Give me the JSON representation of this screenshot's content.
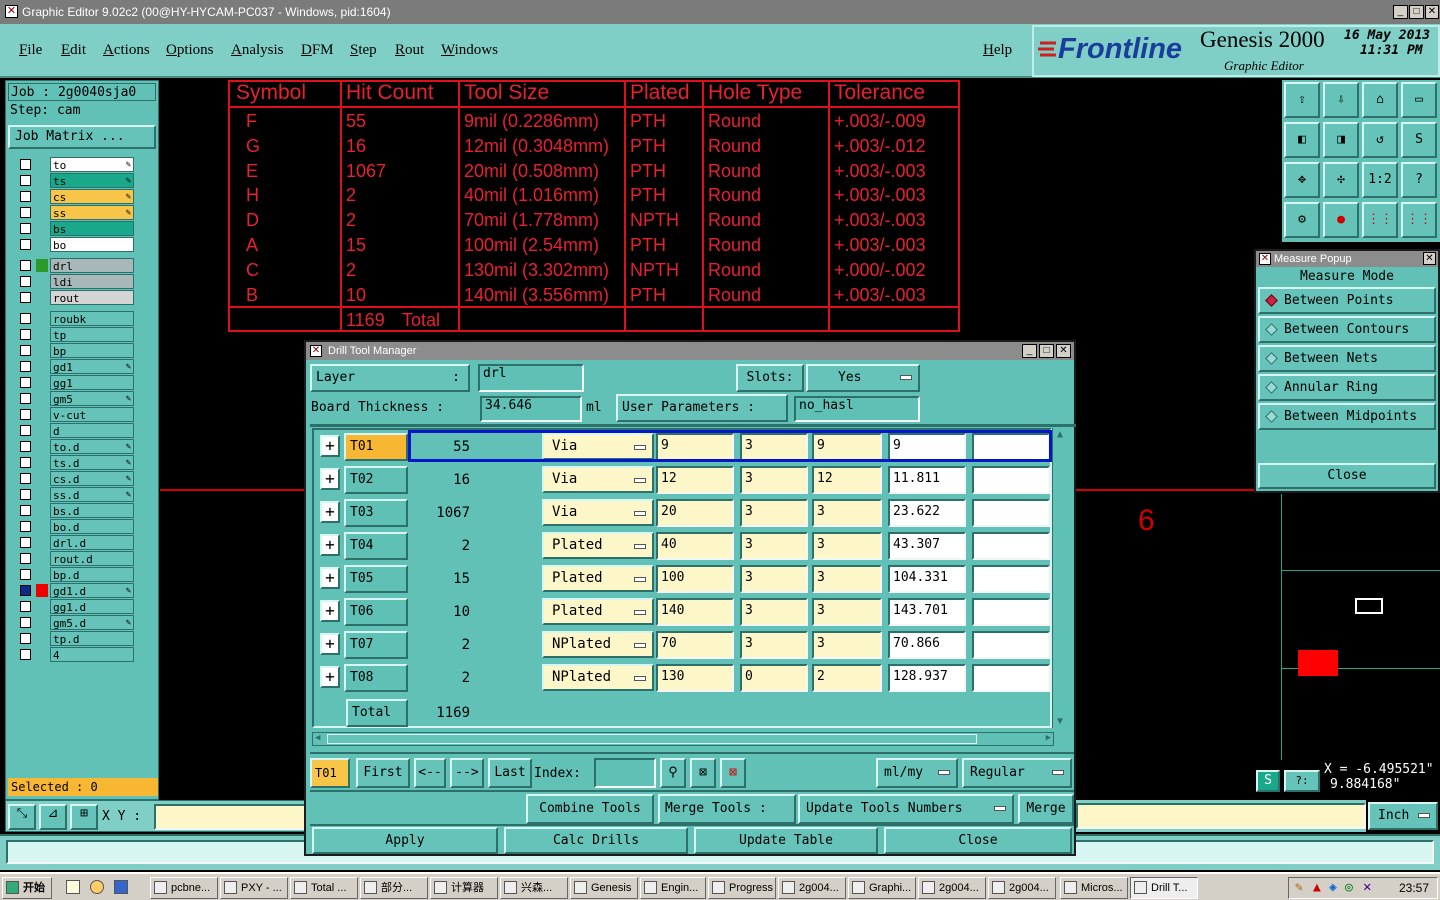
{
  "window": {
    "title": "Graphic Editor 9.02c2 (00@HY-HYCAM-PC037 - Windows, pid:1604)"
  },
  "menu": [
    "File",
    "Edit",
    "Actions",
    "Options",
    "Analysis",
    "DFM",
    "Step",
    "Rout",
    "Windows"
  ],
  "help_label": "Help",
  "brand": {
    "logo": "Frontline",
    "product": "Genesis 2000",
    "subtitle": "Graphic Editor",
    "date": "16 May 2013",
    "time": "11:31 PM"
  },
  "job": {
    "job_label": "Job : 2g0040sja0",
    "step_label": "Step: cam",
    "matrix_button": "Job Matrix ..."
  },
  "layers": [
    {
      "name": "to",
      "color": "#ffffff",
      "pen": true
    },
    {
      "name": "ts",
      "color": "#1aa88a",
      "pen": true
    },
    {
      "name": "cs",
      "color": "#f7c548",
      "pen": true
    },
    {
      "name": "ss",
      "color": "#f7c548",
      "pen": true
    },
    {
      "name": "bs",
      "color": "#1aa88a",
      "pen": false
    },
    {
      "name": "bo",
      "color": "#ffffff",
      "pen": false
    },
    {
      "name": "drl",
      "color": "#a8b8b8",
      "pen": false
    },
    {
      "name": "ldi",
      "color": "#a8b8b8",
      "pen": false
    },
    {
      "name": "rout",
      "color": "#d4d4d4",
      "pen": false
    },
    {
      "name": "roubk",
      "color": "#66c3b9",
      "pen": false
    },
    {
      "name": "tp",
      "color": "#66c3b9",
      "pen": false
    },
    {
      "name": "bp",
      "color": "#66c3b9",
      "pen": false
    },
    {
      "name": "gd1",
      "color": "#66c3b9",
      "pen": true
    },
    {
      "name": "gg1",
      "color": "#66c3b9",
      "pen": false
    },
    {
      "name": "gm5",
      "color": "#66c3b9",
      "pen": true
    },
    {
      "name": "v-cut",
      "color": "#66c3b9",
      "pen": false
    },
    {
      "name": "d",
      "color": "#66c3b9",
      "pen": false
    },
    {
      "name": "to.d",
      "color": "#66c3b9",
      "pen": true
    },
    {
      "name": "ts.d",
      "color": "#66c3b9",
      "pen": true
    },
    {
      "name": "cs.d",
      "color": "#66c3b9",
      "pen": true
    },
    {
      "name": "ss.d",
      "color": "#66c3b9",
      "pen": true
    },
    {
      "name": "bs.d",
      "color": "#66c3b9",
      "pen": false
    },
    {
      "name": "bo.d",
      "color": "#66c3b9",
      "pen": false
    },
    {
      "name": "drl.d",
      "color": "#66c3b9",
      "pen": false
    },
    {
      "name": "rout.d",
      "color": "#66c3b9",
      "pen": false
    },
    {
      "name": "bp.d",
      "color": "#66c3b9",
      "pen": false
    },
    {
      "name": "gd1.d",
      "color": "#66c3b9",
      "pen": true
    },
    {
      "name": "gg1.d",
      "color": "#66c3b9",
      "pen": false
    },
    {
      "name": "gm5.d",
      "color": "#66c3b9",
      "pen": true
    },
    {
      "name": "tp.d",
      "color": "#66c3b9",
      "pen": false
    },
    {
      "name": "4",
      "color": "#66c3b9",
      "pen": false
    }
  ],
  "selected_label": "Selected : 0",
  "xy_label": "X Y :",
  "unit_button": "Inch",
  "drill_table": {
    "headers": [
      "Symbol",
      "Hit Count",
      "Tool Size",
      "Plated",
      "Hole Type",
      "Tolerance"
    ],
    "rows": [
      [
        "F",
        "55",
        "9mil (0.2286mm)",
        "PTH",
        "Round",
        "+.003/-.009"
      ],
      [
        "G",
        "16",
        "12mil (0.3048mm)",
        "PTH",
        "Round",
        "+.003/-.012"
      ],
      [
        "E",
        "1067",
        "20mil (0.508mm)",
        "PTH",
        "Round",
        "+.003/-.003"
      ],
      [
        "H",
        "2",
        "40mil (1.016mm)",
        "PTH",
        "Round",
        "+.003/-.003"
      ],
      [
        "D",
        "2",
        "70mil (1.778mm)",
        "NPTH",
        "Round",
        "+.003/-.003"
      ],
      [
        "A",
        "15",
        "100mil (2.54mm)",
        "PTH",
        "Round",
        "+.003/-.003"
      ],
      [
        "C",
        "2",
        "130mil (3.302mm)",
        "NPTH",
        "Round",
        "+.000/-.002"
      ],
      [
        "B",
        "10",
        "140mil (3.556mm)",
        "PTH",
        "Round",
        "+.003/-.003"
      ]
    ],
    "total_count": "1169",
    "total_label": "Total"
  },
  "canvas_text": "6",
  "coords": {
    "x": "X = -6.495521\"",
    "y": "9.884168\""
  },
  "dtm": {
    "title": "Drill Tool Manager",
    "layer_label": "Layer",
    "layer_value": "drl",
    "slots_label": "Slots:",
    "slots_value": "Yes",
    "thickness_label": "Board Thickness :",
    "thickness_value": "34.646",
    "thickness_unit": "ml",
    "user_params_label": "User Parameters :",
    "user_params_value": "no_hasl",
    "tools": [
      {
        "id": "T01",
        "count": "55",
        "type": "Via",
        "c1": "9",
        "c2": "3",
        "c3": "9",
        "finish": "9",
        "extra": ""
      },
      {
        "id": "T02",
        "count": "16",
        "type": "Via",
        "c1": "12",
        "c2": "3",
        "c3": "12",
        "finish": "11.811",
        "extra": ""
      },
      {
        "id": "T03",
        "count": "1067",
        "type": "Via",
        "c1": "20",
        "c2": "3",
        "c3": "3",
        "finish": "23.622",
        "extra": ""
      },
      {
        "id": "T04",
        "count": "2",
        "type": "Plated",
        "c1": "40",
        "c2": "3",
        "c3": "3",
        "finish": "43.307",
        "extra": ""
      },
      {
        "id": "T05",
        "count": "15",
        "type": "Plated",
        "c1": "100",
        "c2": "3",
        "c3": "3",
        "finish": "104.331",
        "extra": ""
      },
      {
        "id": "T06",
        "count": "10",
        "type": "Plated",
        "c1": "140",
        "c2": "3",
        "c3": "3",
        "finish": "143.701",
        "extra": ""
      },
      {
        "id": "T07",
        "count": "2",
        "type": "NPlated",
        "c1": "70",
        "c2": "3",
        "c3": "3",
        "finish": "70.866",
        "extra": ""
      },
      {
        "id": "T08",
        "count": "2",
        "type": "NPlated",
        "c1": "130",
        "c2": "0",
        "c3": "2",
        "finish": "128.937",
        "extra": ""
      }
    ],
    "total_label": "Total",
    "total_value": "1169",
    "current_tool": "T01",
    "nav": {
      "first": "First",
      "prev": "<--",
      "next": "-->",
      "last": "Last",
      "index_label": "Index:"
    },
    "units_value": "ml/my",
    "mode_value": "Regular",
    "combine_label": "Combine Tools",
    "merge_tools_label": "Merge Tools :",
    "update_numbers_label": "Update Tools Numbers",
    "merge_label": "Merge",
    "apply_label": "Apply",
    "calc_label": "Calc Drills",
    "update_table_label": "Update Table",
    "close_label": "Close"
  },
  "measure": {
    "title": "Measure Popup",
    "mode_label": "Measure Mode",
    "options": [
      "Between Points",
      "Between Contours",
      "Between Nets",
      "Annular Ring",
      "Between Midpoints"
    ],
    "selected": 0,
    "close_label": "Close"
  },
  "taskbar": {
    "start": "开始",
    "items": [
      "pcbne...",
      "PXY - ...",
      "Total ...",
      "部分...",
      "计算器",
      "兴森...",
      "Genesis",
      "Engin...",
      "Progress",
      "2g004...",
      "Graphi...",
      "2g004...",
      "2g004...",
      "Micros...",
      "Drill T..."
    ],
    "clock": "23:57"
  }
}
